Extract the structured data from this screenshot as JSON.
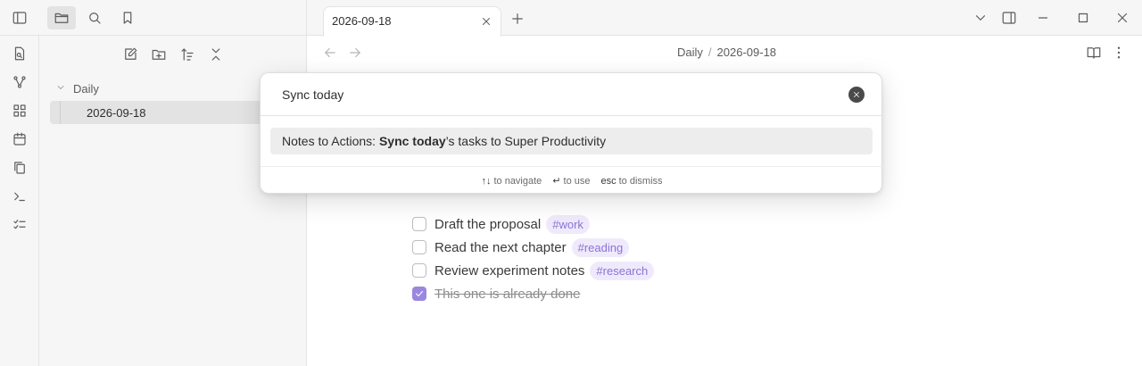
{
  "tabs": [
    {
      "title": "2026-09-18"
    }
  ],
  "breadcrumb": {
    "folder": "Daily",
    "separator": "/",
    "file": "2026-09-18"
  },
  "file_tree": {
    "folder": "Daily",
    "files": [
      "2026-09-18"
    ]
  },
  "prompt": {
    "query": "Sync today",
    "suggestion": {
      "prefix": "Notes to Actions: ",
      "match": "Sync today",
      "suffix": "’s tasks to Super Productivity"
    },
    "instructions": [
      {
        "key": "↑↓",
        "text": "to navigate"
      },
      {
        "key": "↵",
        "text": "to use"
      },
      {
        "key": "esc",
        "text": "to dismiss"
      }
    ]
  },
  "tasks": [
    {
      "text": "Draft the proposal",
      "tag": "#work",
      "done": false
    },
    {
      "text": "Read the next chapter",
      "tag": "#reading",
      "done": false
    },
    {
      "text": "Review experiment notes",
      "tag": "#research",
      "done": false
    },
    {
      "text": "This one is already done",
      "tag": "",
      "done": true
    }
  ],
  "colors": {
    "accent": "#9b86e0",
    "tag_text": "#8a72d8",
    "tag_bg": "#efeafb"
  }
}
